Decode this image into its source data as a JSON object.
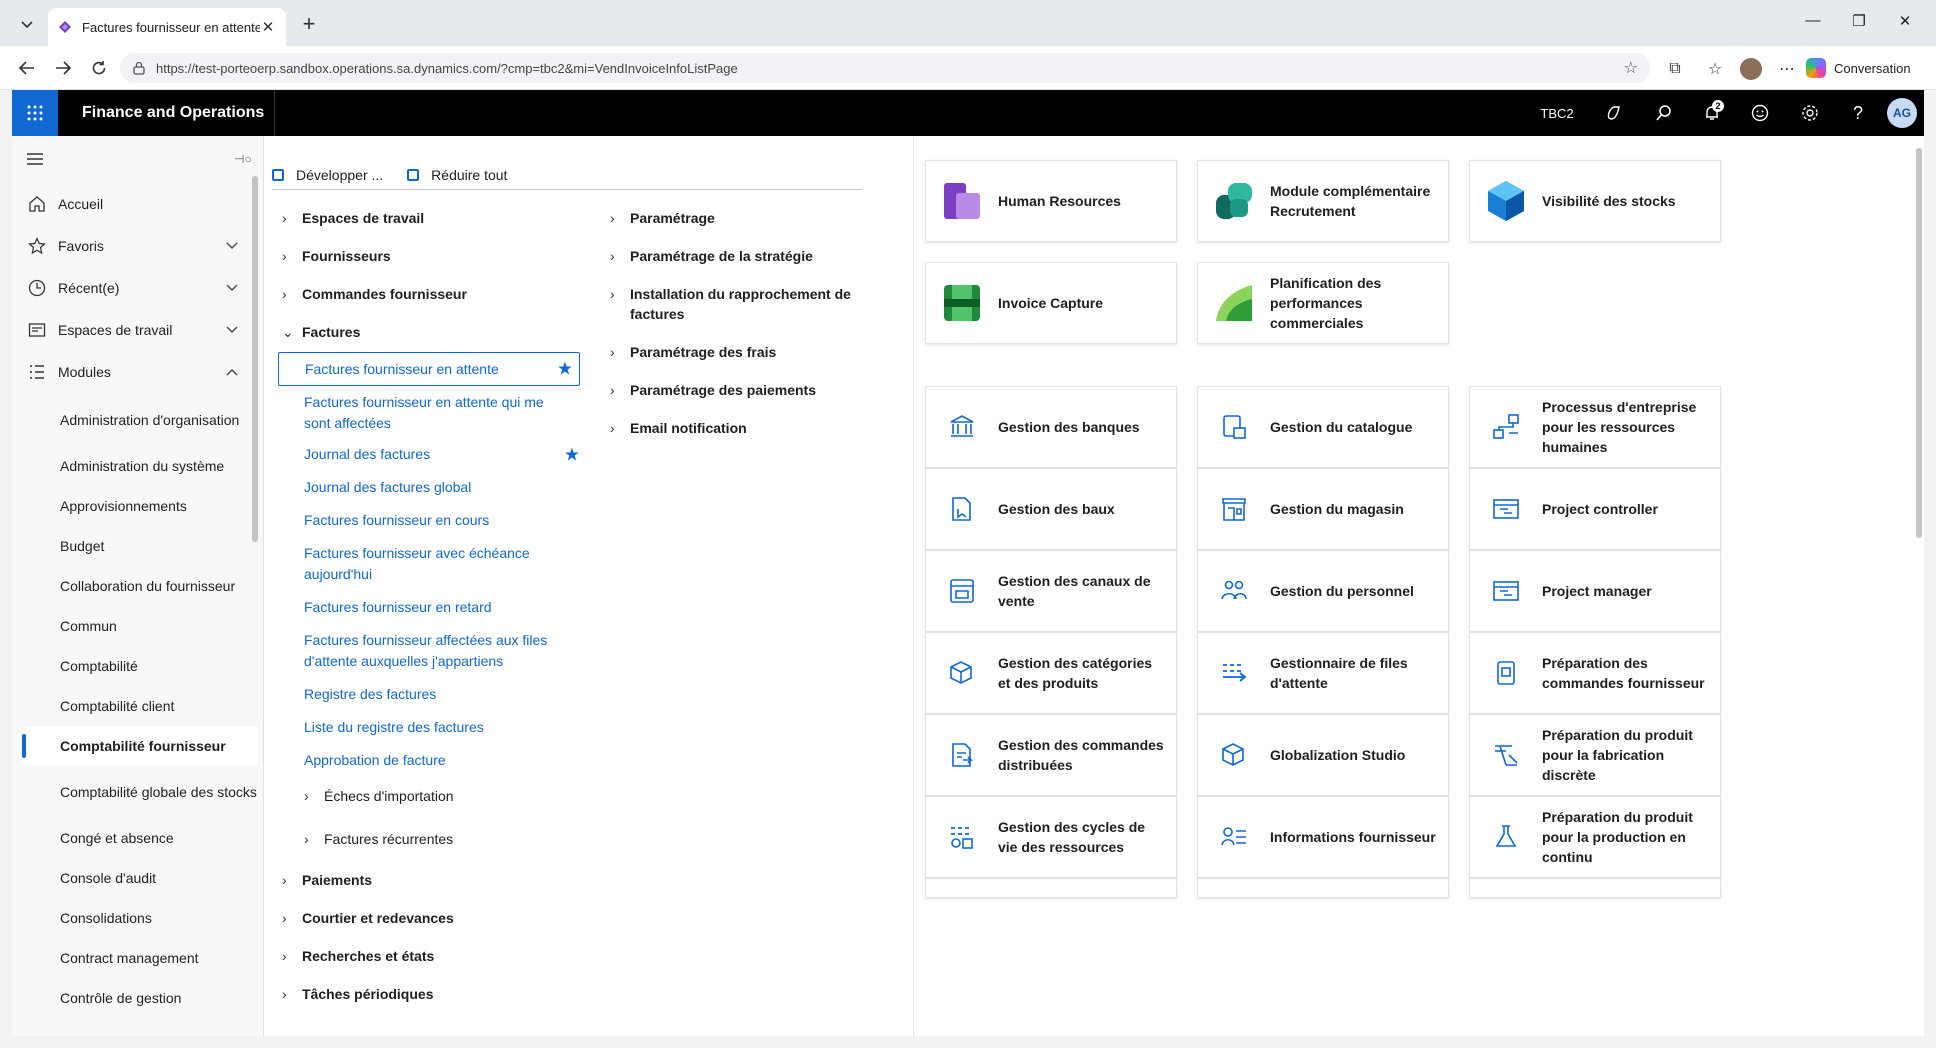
{
  "browser": {
    "tab_title": "Factures fournisseur en attente --",
    "url": "https://test-porteoerp.sandbox.operations.sa.dynamics.com/?cmp=tbc2&mi=VendInvoiceInfoListPage",
    "copilot_label": "Conversation"
  },
  "app": {
    "title": "Finance and Operations",
    "company": "TBC2",
    "notification_count": "2",
    "user_initials": "AG",
    "accent_color": "#1068d0"
  },
  "leftnav": {
    "items": [
      {
        "label": "Accueil",
        "icon": "home-icon"
      },
      {
        "label": "Favoris",
        "icon": "star-icon"
      },
      {
        "label": "Récent(e)",
        "icon": "clock-icon"
      },
      {
        "label": "Espaces de travail",
        "icon": "workspace-icon"
      },
      {
        "label": "Modules",
        "icon": "list-icon"
      }
    ],
    "modules": [
      "Administration d'organisation",
      "Administration du système",
      "Approvisionnements",
      "Budget",
      "Collaboration du fournisseur",
      "Commun",
      "Comptabilité",
      "Comptabilité client",
      "Comptabilité fournisseur",
      "Comptabilité globale des stocks",
      "Congé et absence",
      "Console d'audit",
      "Consolidations",
      "Contract management",
      "Contrôle de gestion"
    ],
    "selected_module": "Comptabilité fournisseur"
  },
  "menu": {
    "expand_label": "Développer ...",
    "collapse_label": "Réduire tout",
    "col1_groups": [
      "Espaces de travail",
      "Fournisseurs",
      "Commandes fournisseur",
      "Factures"
    ],
    "factures_links": [
      "Factures fournisseur en attente",
      "Factures fournisseur en attente qui me sont affectées",
      "Journal des factures",
      "Journal des factures global",
      "Factures fournisseur en cours",
      "Factures fournisseur avec échéance aujourd'hui",
      "Factures fournisseur en retard",
      "Factures fournisseur affectées aux files d'attente auxquelles j'appartiens",
      "Registre des factures",
      "Liste du registre des factures",
      "Approbation de facture"
    ],
    "factures_subgroups": [
      "Échecs d'importation",
      "Factures récurrentes"
    ],
    "col1_groups_after": [
      "Paiements",
      "Courtier et redevances",
      "Recherches et états",
      "Tâches périodiques"
    ],
    "col2_groups": [
      "Paramétrage",
      "Paramétrage de la stratégie",
      "Installation du rapprochement de factures",
      "Paramétrage des frais",
      "Paramétrage des paiements",
      "Email notification"
    ]
  },
  "tiles": [
    {
      "label": "Human Resources",
      "icon": "human-resources-icon"
    },
    {
      "label": "Module complémentaire Recrutement",
      "icon": "recruiting-icon"
    },
    {
      "label": "Visibilité des stocks",
      "icon": "inventory-visibility-icon"
    },
    {
      "label": "Invoice Capture",
      "icon": "invoice-capture-icon"
    },
    {
      "label": "Planification des performances commerciales",
      "icon": "sales-planning-icon"
    },
    {
      "label": "Gestion des banques",
      "icon": "bank-icon"
    },
    {
      "label": "Gestion du catalogue",
      "icon": "catalog-icon"
    },
    {
      "label": "Processus d'entreprise pour les ressources humaines",
      "icon": "process-icon"
    },
    {
      "label": "Gestion des baux",
      "icon": "lease-icon"
    },
    {
      "label": "Gestion du magasin",
      "icon": "store-icon"
    },
    {
      "label": "Project controller",
      "icon": "project-icon"
    },
    {
      "label": "Gestion des canaux de vente",
      "icon": "channel-icon"
    },
    {
      "label": "Gestion du personnel",
      "icon": "people-icon"
    },
    {
      "label": "Project manager",
      "icon": "project-icon"
    },
    {
      "label": "Gestion des catégories et des produits",
      "icon": "product-icon"
    },
    {
      "label": "Gestionnaire de files d'attente",
      "icon": "queue-icon"
    },
    {
      "label": "Préparation des commandes fournisseur",
      "icon": "purchase-icon"
    },
    {
      "label": "Gestion des commandes distribuées",
      "icon": "order-icon"
    },
    {
      "label": "Globalization Studio",
      "icon": "globalization-icon"
    },
    {
      "label": "Préparation du produit pour la fabrication discrète",
      "icon": "manufacturing-icon"
    },
    {
      "label": "Gestion des cycles de vie des ressources",
      "icon": "asset-icon"
    },
    {
      "label": "Informations fournisseur",
      "icon": "vendor-info-icon"
    },
    {
      "label": "Préparation du produit pour la production en continu",
      "icon": "process-manufacturing-icon"
    }
  ]
}
